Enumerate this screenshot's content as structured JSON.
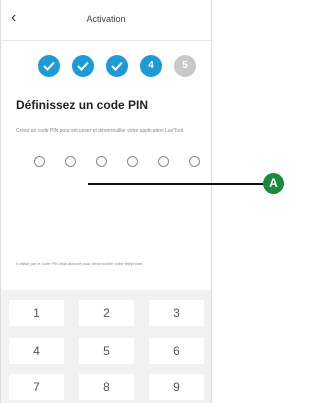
{
  "header": {
    "back_icon": "chevron-left-icon",
    "title": "Activation"
  },
  "steps": [
    {
      "state": "done"
    },
    {
      "state": "done"
    },
    {
      "state": "done"
    },
    {
      "state": "current",
      "label": "4"
    },
    {
      "state": "todo",
      "label": "5"
    }
  ],
  "colors": {
    "accent": "#1d9bd7",
    "inactive": "#c8c8c8",
    "callout": "#1b8a3c"
  },
  "main": {
    "heading": "Définissez un code PIN",
    "description": "Créez un code PIN pour sécuriser et déverrouiller votre application Lux'Tool.",
    "pin_length": 6,
    "info": "Il utilisé par le code PIN déjà associé pour déverrouiller votre téléphone."
  },
  "keypad": {
    "keys": [
      "1",
      "2",
      "3",
      "4",
      "5",
      "6",
      "7",
      "8",
      "9"
    ]
  },
  "callout": {
    "label": "A"
  }
}
